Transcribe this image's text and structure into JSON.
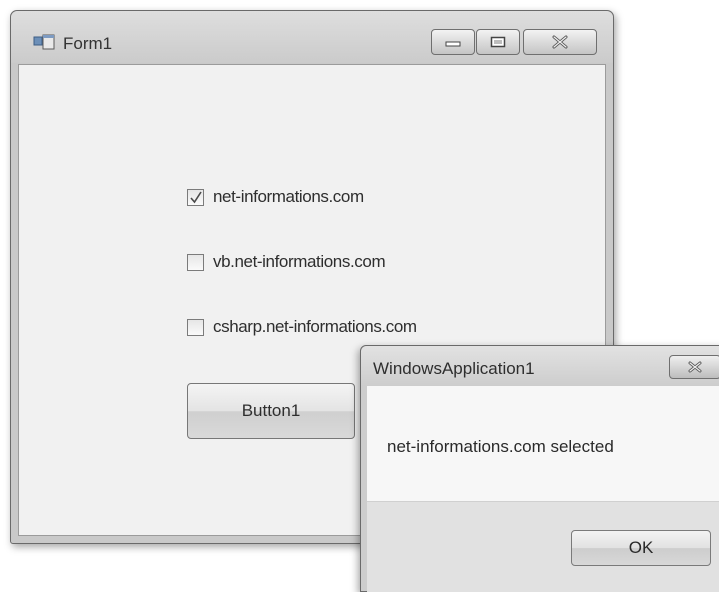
{
  "form": {
    "title": "Form1",
    "icon": "form-window-icon",
    "checkboxes": [
      {
        "label": "net-informations.com",
        "checked": true
      },
      {
        "label": "vb.net-informations.com",
        "checked": false
      },
      {
        "label": "csharp.net-informations.com",
        "checked": false
      }
    ],
    "button_label": "Button1"
  },
  "message_box": {
    "title": "WindowsApplication1",
    "text": "net-informations.com selected",
    "ok_label": "OK"
  },
  "colors": {
    "window_frame": "#c9c9c9",
    "client_background": "#f1f1f1",
    "message_body": "#f7f7f7",
    "message_footer": "#e1e1e1"
  }
}
